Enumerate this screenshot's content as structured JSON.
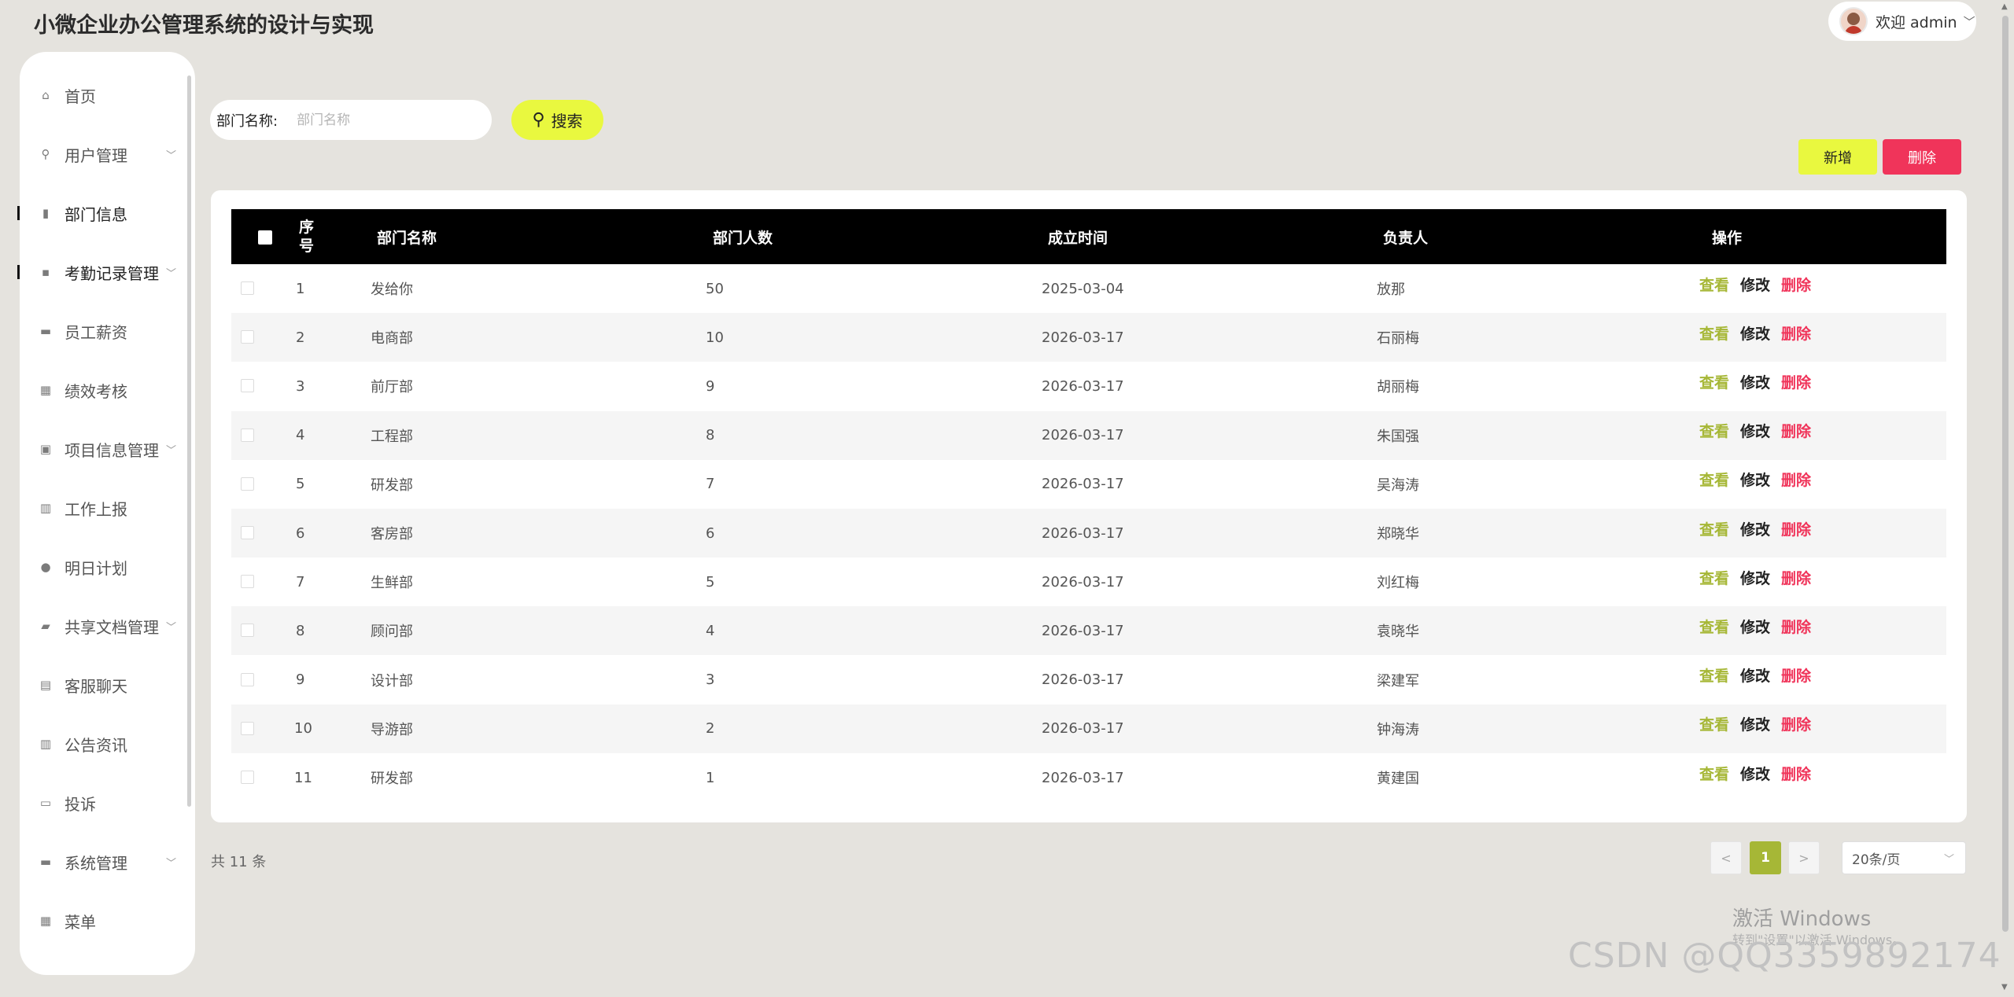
{
  "header": {
    "app_title": "小微企业办公管理系统的设计与实现",
    "user_greeting": "欢迎 admin",
    "user_chevron": "﹀"
  },
  "sidebar": {
    "items": [
      {
        "label": "首页",
        "icon": "⌂",
        "icon_name": "home-icon",
        "has_arrow": false
      },
      {
        "label": "用户管理",
        "icon": "⚲",
        "icon_name": "user-icon",
        "has_arrow": true
      },
      {
        "label": "部门信息",
        "icon": "▮",
        "icon_name": "building-icon",
        "has_arrow": false,
        "active": true
      },
      {
        "label": "考勤记录管理",
        "icon": "▪",
        "icon_name": "attendance-icon",
        "has_arrow": true,
        "active": true
      },
      {
        "label": "员工薪资",
        "icon": "▬",
        "icon_name": "salary-icon",
        "has_arrow": false
      },
      {
        "label": "绩效考核",
        "icon": "▦",
        "icon_name": "performance-icon",
        "has_arrow": false
      },
      {
        "label": "项目信息管理",
        "icon": "▣",
        "icon_name": "project-icon",
        "has_arrow": true
      },
      {
        "label": "工作上报",
        "icon": "▥",
        "icon_name": "report-icon",
        "has_arrow": false
      },
      {
        "label": "明日计划",
        "icon": "●",
        "icon_name": "plan-icon",
        "has_arrow": false
      },
      {
        "label": "共享文档管理",
        "icon": "▰",
        "icon_name": "document-icon",
        "has_arrow": true
      },
      {
        "label": "客服聊天",
        "icon": "▤",
        "icon_name": "chat-icon",
        "has_arrow": false
      },
      {
        "label": "公告资讯",
        "icon": "▥",
        "icon_name": "notice-icon",
        "has_arrow": false
      },
      {
        "label": "投诉",
        "icon": "▭",
        "icon_name": "complaint-icon",
        "has_arrow": false
      },
      {
        "label": "系统管理",
        "icon": "▬",
        "icon_name": "settings-icon",
        "has_arrow": true
      },
      {
        "label": "菜单",
        "icon": "▦",
        "icon_name": "menu-icon",
        "has_arrow": false
      }
    ],
    "arrow_glyph": "﹀"
  },
  "search": {
    "label": "部门名称:",
    "placeholder": "部门名称",
    "button_label": "搜索",
    "button_icon": "⚲"
  },
  "actions": {
    "add_label": "新增",
    "delete_label": "删除"
  },
  "table": {
    "headers": {
      "index": [
        "序",
        "号"
      ],
      "name": "部门名称",
      "count": "部门人数",
      "date": "成立时间",
      "leader": "负责人",
      "ops": "操作"
    },
    "ops": {
      "view": "查看",
      "edit": "修改",
      "delete": "删除"
    },
    "rows": [
      {
        "index": "1",
        "name": "发给你",
        "count": "50",
        "date": "2025-03-04",
        "leader": "放那"
      },
      {
        "index": "2",
        "name": "电商部",
        "count": "10",
        "date": "2026-03-17",
        "leader": "石丽梅"
      },
      {
        "index": "3",
        "name": "前厅部",
        "count": "9",
        "date": "2026-03-17",
        "leader": "胡丽梅"
      },
      {
        "index": "4",
        "name": "工程部",
        "count": "8",
        "date": "2026-03-17",
        "leader": "朱国强"
      },
      {
        "index": "5",
        "name": "研发部",
        "count": "7",
        "date": "2026-03-17",
        "leader": "吴海涛"
      },
      {
        "index": "6",
        "name": "客房部",
        "count": "6",
        "date": "2026-03-17",
        "leader": "郑晓华"
      },
      {
        "index": "7",
        "name": "生鲜部",
        "count": "5",
        "date": "2026-03-17",
        "leader": "刘红梅"
      },
      {
        "index": "8",
        "name": "顾问部",
        "count": "4",
        "date": "2026-03-17",
        "leader": "袁晓华"
      },
      {
        "index": "9",
        "name": "设计部",
        "count": "3",
        "date": "2026-03-17",
        "leader": "梁建军"
      },
      {
        "index": "10",
        "name": "导游部",
        "count": "2",
        "date": "2026-03-17",
        "leader": "钟海涛"
      },
      {
        "index": "11",
        "name": "研发部",
        "count": "1",
        "date": "2026-03-17",
        "leader": "黄建国"
      }
    ]
  },
  "pagination": {
    "total_text": "共 11 条",
    "prev": "<",
    "current": "1",
    "next": ">",
    "page_size": "20条/页",
    "page_size_chevron": "﹀"
  },
  "watermarks": {
    "activate_title": "激活 Windows",
    "activate_sub": "转到\"设置\"以激活 Windows。",
    "csdn": "CSDN @QQ3359892174"
  },
  "scrollbar": {
    "up": "▲",
    "down": "▼"
  }
}
